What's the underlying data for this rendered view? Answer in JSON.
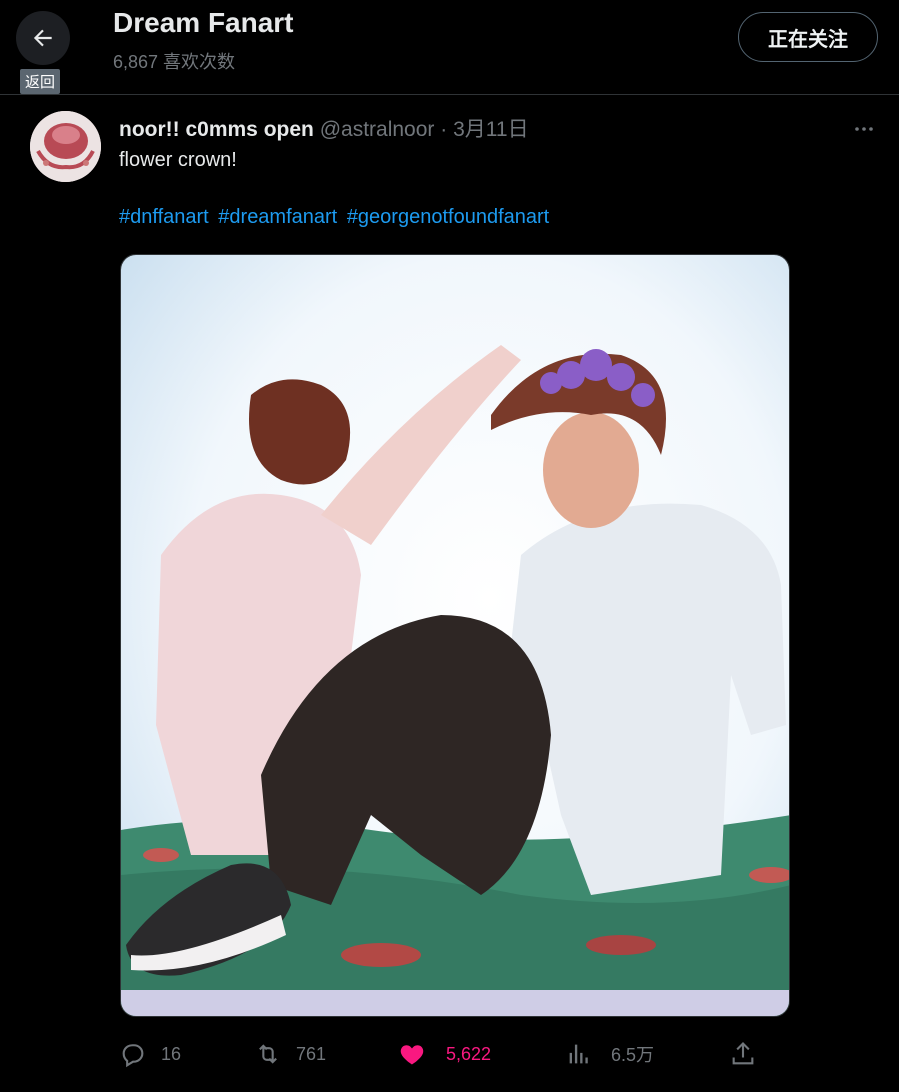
{
  "header": {
    "back_tooltip": "返回",
    "title": "Dream Fanart",
    "subtitle": "6,867 喜欢次数",
    "follow_label": "正在关注"
  },
  "tweet": {
    "author_name": "noor!! c0mms open",
    "handle": "@astralnoor",
    "separator": "·",
    "date": "3月11日",
    "text": "flower crown!",
    "hashtags": [
      "#dnffanart",
      "#dreamfanart",
      "#georgenotfoundfanart"
    ],
    "stats": {
      "replies": "16",
      "retweets": "761",
      "likes": "5,622",
      "views": "6.5万"
    }
  },
  "colors": {
    "background": "#000000",
    "link": "#1d9bf0",
    "like_active": "#f91880",
    "muted": "#71767b"
  },
  "icons": [
    "back-arrow-icon",
    "more-icon",
    "reply-icon",
    "retweet-icon",
    "heart-icon",
    "views-icon",
    "share-icon"
  ]
}
